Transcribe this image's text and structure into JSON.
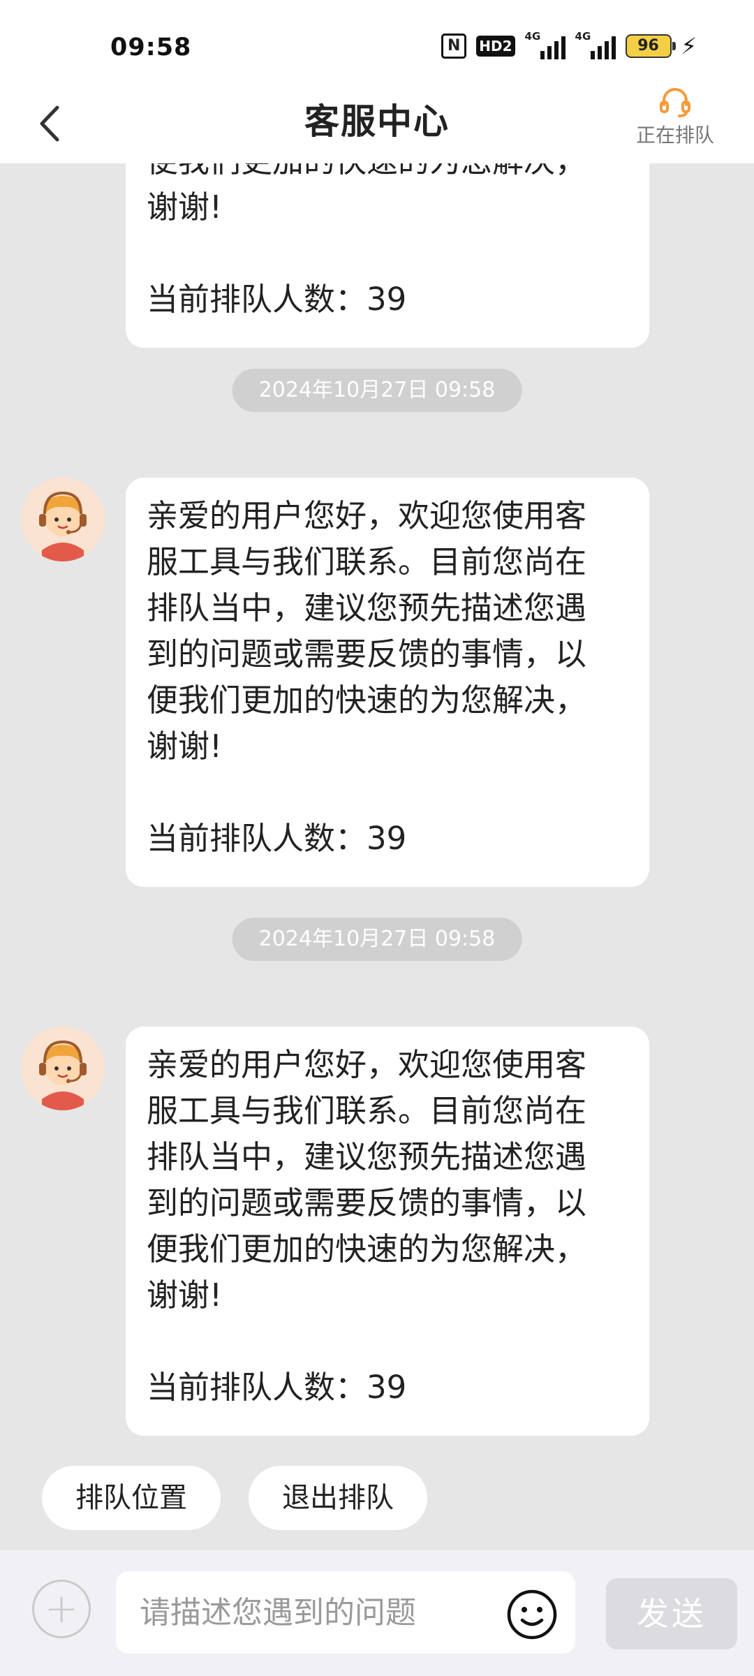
{
  "status_bar": {
    "time": "09:58",
    "nfc_label": "N",
    "hd_label": "HD2",
    "signal_1_label": "4G",
    "signal_2_label": "4G",
    "battery_level": "96",
    "charging_icon": "bolt-icon"
  },
  "header": {
    "back_icon": "chevron-left-icon",
    "title": "客服中心",
    "queue_icon": "headset-icon",
    "queue_label": "正在排队"
  },
  "messages": [
    {
      "text": "便我们更加的快速的为您解决，\n谢谢!",
      "queue_count": "当前排队人数：39"
    },
    {
      "timestamp": "2024年10月27日 09:58",
      "text": "亲爱的用户您好，欢迎您使用客\n服工具与我们联系。目前您尚在\n排队当中，建议您预先描述您遇\n到的问题或需要反馈的事情，以\n便我们更加的快速的为您解决，\n谢谢!",
      "queue_count": "当前排队人数：39"
    },
    {
      "timestamp": "2024年10月27日 09:58",
      "text": "亲爱的用户您好，欢迎您使用客\n服工具与我们联系。目前您尚在\n排队当中，建议您预先描述您遇\n到的问题或需要反馈的事情，以\n便我们更加的快速的为您解决，\n谢谢!",
      "queue_count": "当前排队人数：39"
    }
  ],
  "quick_actions": {
    "queue_position": "排队位置",
    "exit_queue": "退出排队"
  },
  "input_bar": {
    "plus_symbol": "+",
    "placeholder": "请描述您遇到的问题",
    "value": "",
    "emoji_icon": "smiley-icon",
    "send_label": "发送"
  },
  "colors": {
    "accent_orange": "#f59a3c",
    "chat_background": "#e6e6e6",
    "timestamp_pill": "#d0d0d0",
    "send_disabled": "#dcdce0"
  }
}
